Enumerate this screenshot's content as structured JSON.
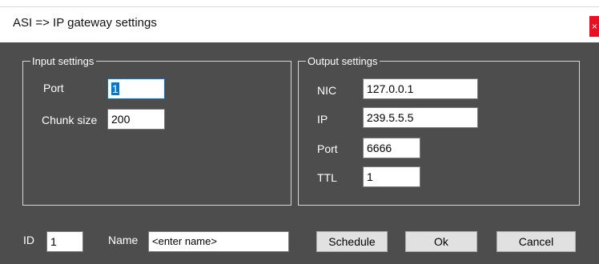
{
  "window": {
    "title": "ASI => IP gateway settings",
    "close_glyph": "×",
    "close_color": "#e81123",
    "background_color": "#4d4d4d"
  },
  "input_settings": {
    "legend": "Input settings",
    "port_label": "Port",
    "port_value": "1",
    "chunk_size_label": "Chunk size",
    "chunk_size_value": "200"
  },
  "output_settings": {
    "legend": "Output settings",
    "nic_label": "NIC",
    "nic_value": "127.0.0.1",
    "ip_label": "IP",
    "ip_value": "239.5.5.5",
    "port_label": "Port",
    "port_value": "6666",
    "ttl_label": "TTL",
    "ttl_value": "1"
  },
  "footer": {
    "id_label": "ID",
    "id_value": "1",
    "name_label": "Name",
    "name_value": "<enter name>",
    "schedule_label": "Schedule",
    "ok_label": "Ok",
    "cancel_label": "Cancel"
  }
}
